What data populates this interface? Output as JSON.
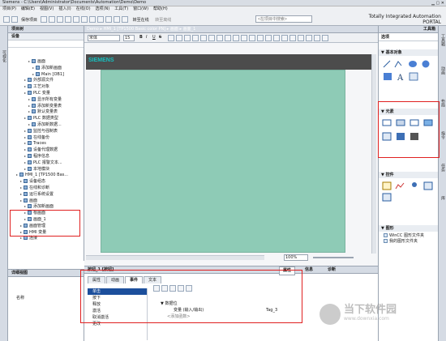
{
  "app": {
    "title": "Siemens - C:\\Users\\Administrator\\Documents\\Automation\\Demo\\Demo",
    "brand": "Totally Integrated Automation",
    "brand_sub": "PORTAL"
  },
  "menu": [
    "项目(P)",
    "编辑(E)",
    "视图(V)",
    "插入(I)",
    "在线(O)",
    "选项(N)",
    "工具(T)",
    "窗口(W)",
    "帮助(H)"
  ],
  "toolbar": {
    "save_label": "保存项目",
    "online_label": "转至在线",
    "offline_label": "转至离线",
    "search_placeholder": "<在项目中搜索>"
  },
  "left_panel": {
    "title": "项目树",
    "section": "设备",
    "vertical_tab": "可视化",
    "tree": [
      {
        "label": "画面",
        "indent": 5,
        "icon": "folder"
      },
      {
        "label": "添加新画面",
        "indent": 6,
        "icon": "add"
      },
      {
        "label": "Main [OB1]",
        "indent": 6,
        "icon": "block"
      },
      {
        "label": "外部源文件",
        "indent": 4,
        "icon": "folder"
      },
      {
        "label": "工艺对象",
        "indent": 4,
        "icon": "folder"
      },
      {
        "label": "PLC 变量",
        "indent": 4,
        "icon": "folder"
      },
      {
        "label": "显示所有变量",
        "indent": 5,
        "icon": "table"
      },
      {
        "label": "添加新变量表",
        "indent": 5,
        "icon": "add"
      },
      {
        "label": "默认变量表",
        "indent": 5,
        "icon": "table"
      },
      {
        "label": "PLC 数据类型",
        "indent": 4,
        "icon": "folder"
      },
      {
        "label": "添加新数据...",
        "indent": 5,
        "icon": "add"
      },
      {
        "label": "监控与强制表",
        "indent": 4,
        "icon": "folder"
      },
      {
        "label": "在线备份",
        "indent": 4,
        "icon": "folder"
      },
      {
        "label": "Traces",
        "indent": 4,
        "icon": "folder"
      },
      {
        "label": "设备代理数据",
        "indent": 4,
        "icon": "folder"
      },
      {
        "label": "程序信息",
        "indent": 4,
        "icon": "info"
      },
      {
        "label": "PLC 报警文本...",
        "indent": 4,
        "icon": "table"
      },
      {
        "label": "本地模块",
        "indent": 4,
        "icon": "folder"
      },
      {
        "label": "HMI_1 [TP1500 Bas...",
        "indent": 2,
        "icon": "device"
      },
      {
        "label": "设备组态",
        "indent": 3,
        "icon": "config"
      },
      {
        "label": "在线和诊断",
        "indent": 3,
        "icon": "diag"
      },
      {
        "label": "运行系统设置",
        "indent": 3,
        "icon": "config"
      },
      {
        "label": "画面",
        "indent": 3,
        "icon": "folder"
      },
      {
        "label": "添加新画面",
        "indent": 4,
        "icon": "add"
      },
      {
        "label": "根画面",
        "indent": 4,
        "icon": "screen"
      },
      {
        "label": "画面_1",
        "indent": 4,
        "icon": "screen"
      },
      {
        "label": "画面管理",
        "indent": 3,
        "icon": "folder"
      },
      {
        "label": "HMI 变量",
        "indent": 3,
        "icon": "folder"
      },
      {
        "label": "连接",
        "indent": 3,
        "icon": "conn"
      }
    ],
    "detail_title": "详细视图",
    "detail_col": "名称"
  },
  "editor": {
    "breadcrumb": [
      "Demo",
      "HMI_1 [TP1500 Basic color PN]",
      "画面",
      "画面_1"
    ],
    "font_name": "宋体",
    "font_size": "15",
    "bold": "B",
    "italic": "I",
    "underline": "U",
    "strike": "S",
    "logo": "SIEMENS",
    "zoom": "100%",
    "canvas_color": "#8ecbb6"
  },
  "props": {
    "title": "按钮_1 [按钮]",
    "tab_props": "属性",
    "tab_info": "信息",
    "tab_diag": "诊断",
    "tabs": [
      "属性",
      "动画",
      "事件",
      "文本"
    ],
    "events": [
      "单击",
      "按下",
      "释放",
      "激活",
      "取消激活",
      "更改"
    ],
    "function_header": "数据位",
    "var_label": "变量 (输入/输出)",
    "var_value": "Tag_3",
    "add_fn": "<添加函数>"
  },
  "right_panel": {
    "title": "工具箱",
    "options": "选项",
    "basic_objects": "基本对象",
    "elements": "元素",
    "controls": "控件",
    "graphics": "图形",
    "graphics_items": [
      "WinCC 图形文件夹",
      "我的图形文件夹"
    ],
    "vtabs": [
      "工具箱",
      "动画",
      "布局",
      "指令",
      "任务",
      "库"
    ]
  },
  "watermark": {
    "text": "当下软件园",
    "url": "www.downxia.com"
  },
  "colors": {
    "canvas": "#8ecbb6",
    "brand": "#009999",
    "highlight": "#e02020"
  }
}
